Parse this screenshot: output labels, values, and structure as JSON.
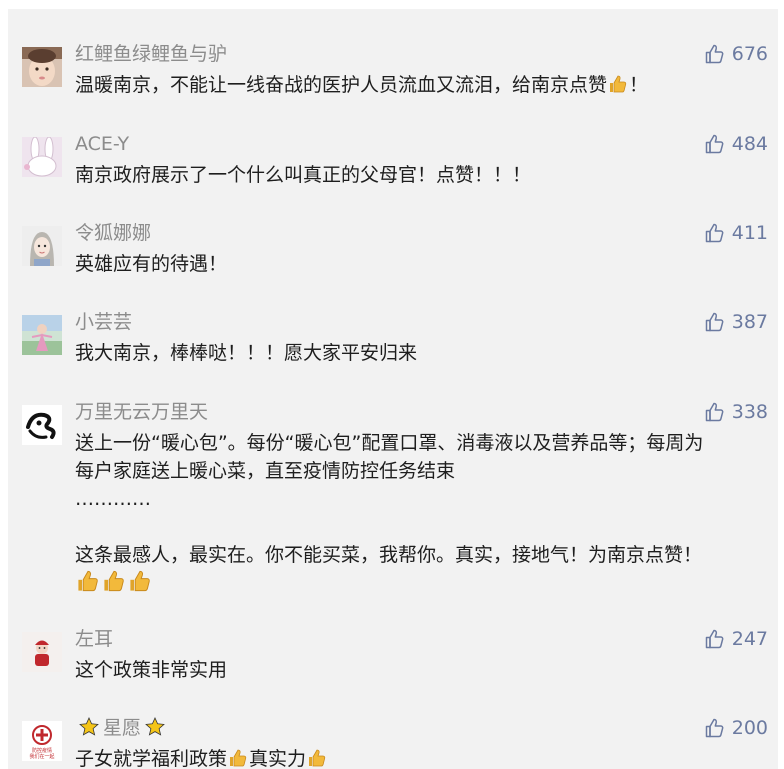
{
  "comments": [
    {
      "name": "红鲤鱼绿鲤鱼与驴",
      "likes": "676",
      "avatar": "baby-photo-avatar",
      "text_before": "温暖南京，不能让一线奋战的医护人员流血又流泪，给南京点赞",
      "text_after": "！"
    },
    {
      "name": "ACE-Y",
      "likes": "484",
      "avatar": "bunny-photo-avatar",
      "text": "南京政府展示了一个什么叫真正的父母官！点赞！！！"
    },
    {
      "name": "令狐娜娜",
      "likes": "411",
      "avatar": "cartoon-girl-avatar",
      "text": "英雄应有的待遇！"
    },
    {
      "name": "小芸芸",
      "likes": "387",
      "avatar": "girl-outdoor-avatar",
      "text": "我大南京，棒棒哒！！！愿大家平安归来"
    },
    {
      "name": "万里无云万里天",
      "likes": "338",
      "avatar": "ink-yinyang-avatar",
      "lines": [
        "送上一份“暖心包”。每份“暖心包”配置口罩、消毒液以及营养品等；每周为",
        "每户家庭送上暖心菜，直至疫情防控任务结束",
        "…………",
        "",
        "这条最感人，最实在。你不能买菜，我帮你。真实，接地气！为南京点赞！"
      ]
    },
    {
      "name": "左耳",
      "likes": "247",
      "avatar": "red-doll-avatar",
      "text": "这个政策非常实用"
    },
    {
      "name": "星愿",
      "likes": "200",
      "avatar": "epidemic-seal-avatar",
      "avatar_text": "防控疫情 我们在一起",
      "text_part1": "子女就学福利政策",
      "text_part2": "真实力"
    }
  ],
  "colors": {
    "background": "#f2f2f2",
    "name": "#8c8c8c",
    "text": "#1e1e1e",
    "like": "#6b7aa0",
    "emoji_thumb": "#f2b93b"
  },
  "icons": {
    "like": "thumbs-up-outline-icon",
    "emoji": "thumbs-up-emoji-icon",
    "star": "star-emoji-icon"
  }
}
